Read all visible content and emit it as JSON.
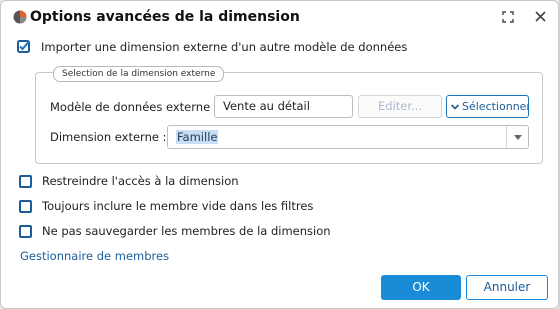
{
  "dialog": {
    "title": "Options avancées de la dimension",
    "icons": {
      "app": "app-logo-icon",
      "maximize": "maximize-icon",
      "close": "close-icon"
    }
  },
  "import_external": {
    "label": "Importer une dimension externe d'un autre modèle de données",
    "checked": true
  },
  "external_selection": {
    "legend": "Selection de la dimension externe",
    "model_label": "Modèle de données externe :",
    "model_value": "Vente au détail",
    "edit_label": "Editer...",
    "edit_enabled": false,
    "select_label": "Sélectionner",
    "dimension_label": "Dimension externe :",
    "dimension_value": "Famille"
  },
  "options": [
    {
      "label": "Restreindre l'accès à la dimension",
      "checked": false
    },
    {
      "label": "Toujours inclure le membre vide dans les filtres",
      "checked": false
    },
    {
      "label": "Ne pas sauvegarder les membres de la dimension",
      "checked": false
    }
  ],
  "link_label": "Gestionnaire de membres",
  "buttons": {
    "ok": "OK",
    "cancel": "Annuler"
  },
  "colors": {
    "accent": "#1a8bd6",
    "link": "#1c5d99"
  }
}
